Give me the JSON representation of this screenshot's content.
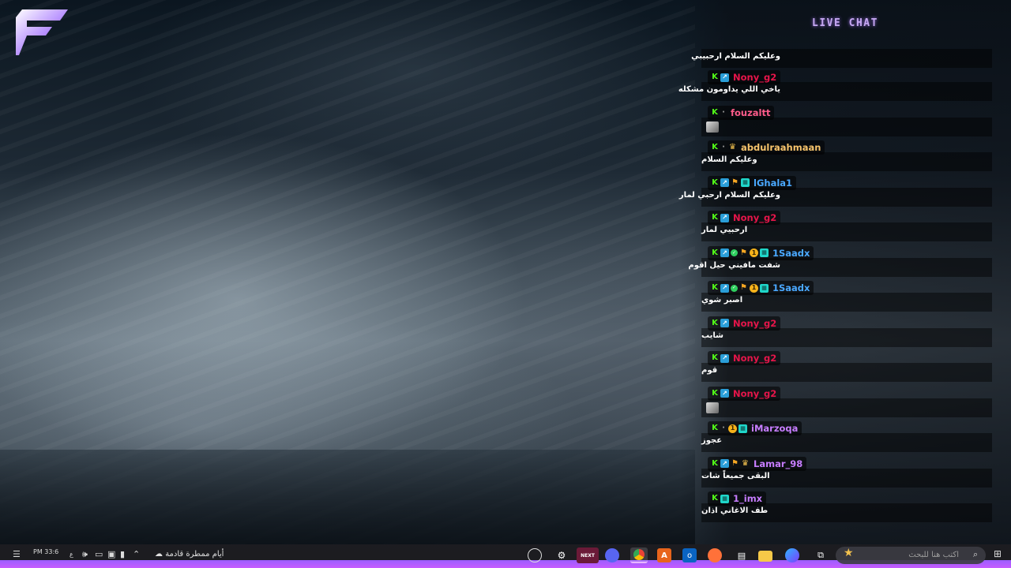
{
  "chat_title": "LIVE CHAT",
  "messages": [
    {
      "user": "",
      "color": "",
      "badges": [],
      "text": "وعليكم السلام ارحبيبي",
      "image": false
    },
    {
      "user": "Nony_g2",
      "color": "#e6154a",
      "badges": [
        "kick",
        "sub"
      ],
      "text": "ياخي اللي يداومون مشكله",
      "image": false
    },
    {
      "user": "fouzaltt",
      "color": "#ff5c8a",
      "badges": [
        "kick",
        "dot"
      ],
      "text": "",
      "image": true
    },
    {
      "user": "abdulraahmaan",
      "color": "#f7c46c",
      "badges": [
        "kick",
        "dot",
        "crown"
      ],
      "text": "وعليكم السلام",
      "image": false
    },
    {
      "user": "lGhala1",
      "color": "#4aa8ff",
      "badges": [
        "kick",
        "sub",
        "founder",
        "gift"
      ],
      "text": "وعليكم السلام ارحبي لمار",
      "image": false
    },
    {
      "user": "Nony_g2",
      "color": "#e6154a",
      "badges": [
        "kick",
        "sub"
      ],
      "text": "ارحبيي لمار",
      "image": false
    },
    {
      "user": "1Saadx",
      "color": "#4aa8ff",
      "badges": [
        "kick",
        "sub",
        "verified",
        "founder",
        "og",
        "gift"
      ],
      "text": "شفت مافيني حيل اقوم",
      "image": false
    },
    {
      "user": "1Saadx",
      "color": "#4aa8ff",
      "badges": [
        "kick",
        "sub",
        "verified",
        "founder",
        "og",
        "gift"
      ],
      "text": "اصبر شوي",
      "image": false
    },
    {
      "user": "Nony_g2",
      "color": "#e6154a",
      "badges": [
        "kick",
        "sub"
      ],
      "text": "شايب",
      "image": false
    },
    {
      "user": "Nony_g2",
      "color": "#e6154a",
      "badges": [
        "kick",
        "sub"
      ],
      "text": "قوم",
      "image": false
    },
    {
      "user": "Nony_g2",
      "color": "#e6154a",
      "badges": [
        "kick",
        "sub"
      ],
      "text": "",
      "image": true
    },
    {
      "user": "iMarzoqa",
      "color": "#c77dff",
      "badges": [
        "kick",
        "dot",
        "og",
        "gift"
      ],
      "text": "عجوز",
      "image": false
    },
    {
      "user": "Lamar_98",
      "color": "#c77dff",
      "badges": [
        "kick",
        "sub",
        "founder",
        "crown"
      ],
      "text": "البقى جميعاً شات",
      "image": false
    },
    {
      "user": "1_imx",
      "color": "#c77dff",
      "badges": [
        "kick",
        "gift"
      ],
      "text": "طف الاغاني اذان",
      "image": false
    }
  ],
  "taskbar": {
    "time": "PM 33:6",
    "weather": "أيام ممطرة قادمة",
    "search_placeholder": "اكتب هنا للبحث",
    "next_label": "NEXT"
  },
  "colors": {
    "accent_purple": "#b36bff",
    "kick_green": "#53fc18"
  }
}
